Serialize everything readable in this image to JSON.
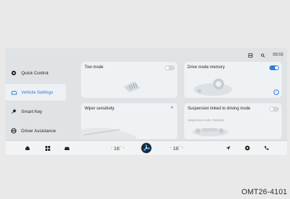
{
  "status": {
    "time": "09:03"
  },
  "sidebar": {
    "items": [
      {
        "label": "Quick Control",
        "icon": "quick-control-icon",
        "active": false
      },
      {
        "label": "Vehicle Settings",
        "icon": "car-icon",
        "active": true
      },
      {
        "label": "Smart Key",
        "icon": "key-icon",
        "active": false
      },
      {
        "label": "Driver Assistance",
        "icon": "steering-wheel-icon",
        "active": false
      }
    ]
  },
  "cards": {
    "tow": {
      "title": "Tow mode",
      "toggle": "off"
    },
    "memory": {
      "title": "Drive mode memory",
      "toggle": "on"
    },
    "wiper": {
      "title": "Wiper sensitivity",
      "chevron": ">"
    },
    "suspension": {
      "title": "Suspension linked to driving mode",
      "subtitle": "Suspension mode: Standard",
      "toggle": "off"
    }
  },
  "bottombar": {
    "temp_left": {
      "value": "16",
      "dec": "‹",
      "inc": "›",
      "unit_symbol": "°"
    },
    "temp_right": {
      "value": "16",
      "dec": "‹",
      "inc": "›",
      "unit_symbol": "°"
    }
  },
  "caption": "OMT26-4101",
  "colors": {
    "accent": "#2b7fe0",
    "screen_bg": "#dfe3e6",
    "card_bg": "#eff2f4"
  }
}
